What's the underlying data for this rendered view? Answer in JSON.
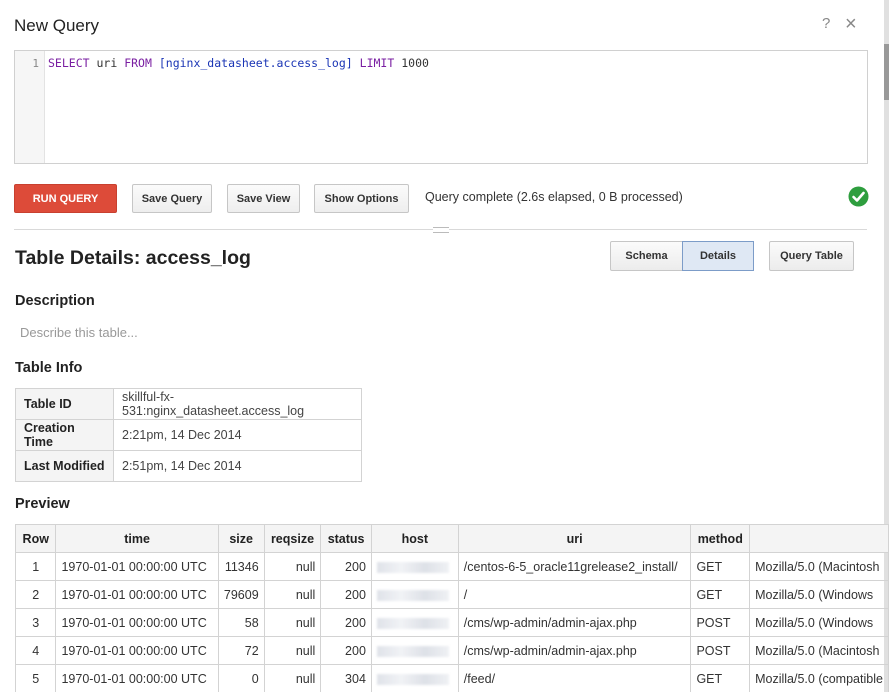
{
  "dialog": {
    "title": "New Query",
    "help_label": "?",
    "close_label": "×"
  },
  "editor": {
    "line_number": "1",
    "tokens": {
      "select": "SELECT",
      "col": "uri",
      "from": "FROM",
      "table": "[nginx_datasheet.access_log]",
      "limit": "LIMIT",
      "limit_value": "1000"
    }
  },
  "toolbar": {
    "run_label": "RUN QUERY",
    "save_query_label": "Save Query",
    "save_view_label": "Save View",
    "show_options_label": "Show Options",
    "status": "Query complete (2.6s elapsed, 0 B processed)",
    "status_icon": "check-circle-icon",
    "colors": {
      "run": "#dd4b39",
      "ok": "#2e9e3e"
    }
  },
  "details": {
    "title": "Table Details: access_log",
    "tabs": {
      "schema": "Schema",
      "details": "Details"
    },
    "query_table_label": "Query Table",
    "description_heading": "Description",
    "description_placeholder": "Describe this table...",
    "info_heading": "Table Info",
    "info": [
      {
        "key": "Table ID",
        "value": "skillful-fx-531:nginx_datasheet.access_log"
      },
      {
        "key": "Creation Time",
        "value": "2:21pm, 14 Dec 2014"
      },
      {
        "key": "Last Modified",
        "value": "2:51pm, 14 Dec 2014"
      }
    ],
    "preview_heading": "Preview"
  },
  "preview": {
    "columns": [
      "Row",
      "time",
      "size",
      "reqsize",
      "status",
      "host",
      "uri",
      "method",
      ""
    ],
    "rows": [
      [
        "1",
        "1970-01-01 00:00:00 UTC",
        "11346",
        "null",
        "200",
        "",
        "/centos-6-5_oracle11grelease2_install/",
        "GET",
        "Mozilla/5.0 (Macintosh"
      ],
      [
        "2",
        "1970-01-01 00:00:00 UTC",
        "79609",
        "null",
        "200",
        "",
        "/",
        "GET",
        "Mozilla/5.0 (Windows"
      ],
      [
        "3",
        "1970-01-01 00:00:00 UTC",
        "58",
        "null",
        "200",
        "",
        "/cms/wp-admin/admin-ajax.php",
        "POST",
        "Mozilla/5.0 (Windows"
      ],
      [
        "4",
        "1970-01-01 00:00:00 UTC",
        "72",
        "null",
        "200",
        "",
        "/cms/wp-admin/admin-ajax.php",
        "POST",
        "Mozilla/5.0 (Macintosh"
      ],
      [
        "5",
        "1970-01-01 00:00:00 UTC",
        "0",
        "null",
        "304",
        "",
        "/feed/",
        "GET",
        "Mozilla/5.0 (compatible"
      ]
    ]
  }
}
